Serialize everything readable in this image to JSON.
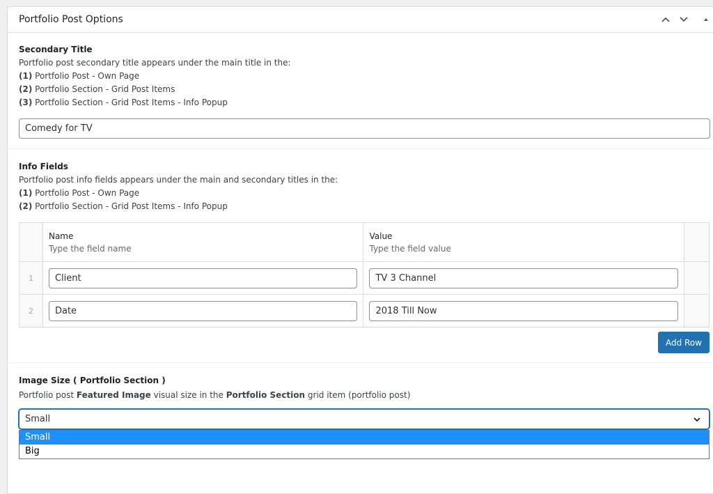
{
  "postbox": {
    "title": "Portfolio Post Options"
  },
  "secondary": {
    "label": "Secondary Title",
    "desc_intro": "Portfolio post secondary title appears under the main title in the:",
    "list": [
      {
        "num": "(1)",
        "text": " Portfolio Post - Own Page"
      },
      {
        "num": "(2)",
        "text": " Portfolio Section - Grid Post Items"
      },
      {
        "num": "(3)",
        "text": " Portfolio Section - Grid Post Items - Info Popup"
      }
    ],
    "value": "Comedy for TV"
  },
  "info": {
    "label": "Info Fields",
    "desc_intro": "Portfolio post info fields appears under the main and secondary titles in the:",
    "list": [
      {
        "num": "(1)",
        "text": " Portfolio Post - Own Page"
      },
      {
        "num": "(2)",
        "text": " Portfolio Section - Grid Post Items - Info Popup"
      }
    ],
    "columns": [
      {
        "label": "Name",
        "sub": "Type the field name"
      },
      {
        "label": "Value",
        "sub": "Type the field value"
      }
    ],
    "rows": [
      {
        "index": "1",
        "name": "Client",
        "value": "TV 3 Channel"
      },
      {
        "index": "2",
        "name": "Date",
        "value": "2018 Till Now"
      }
    ],
    "add_row_label": "Add Row"
  },
  "image_size": {
    "label": "Image Size ( Portfolio Section )",
    "desc_parts": [
      "Portfolio post ",
      "Featured Image",
      " visual size in the ",
      "Portfolio Section",
      " grid item (portfolio post)"
    ],
    "selected": "Small",
    "options": [
      "Small",
      "Big"
    ]
  }
}
